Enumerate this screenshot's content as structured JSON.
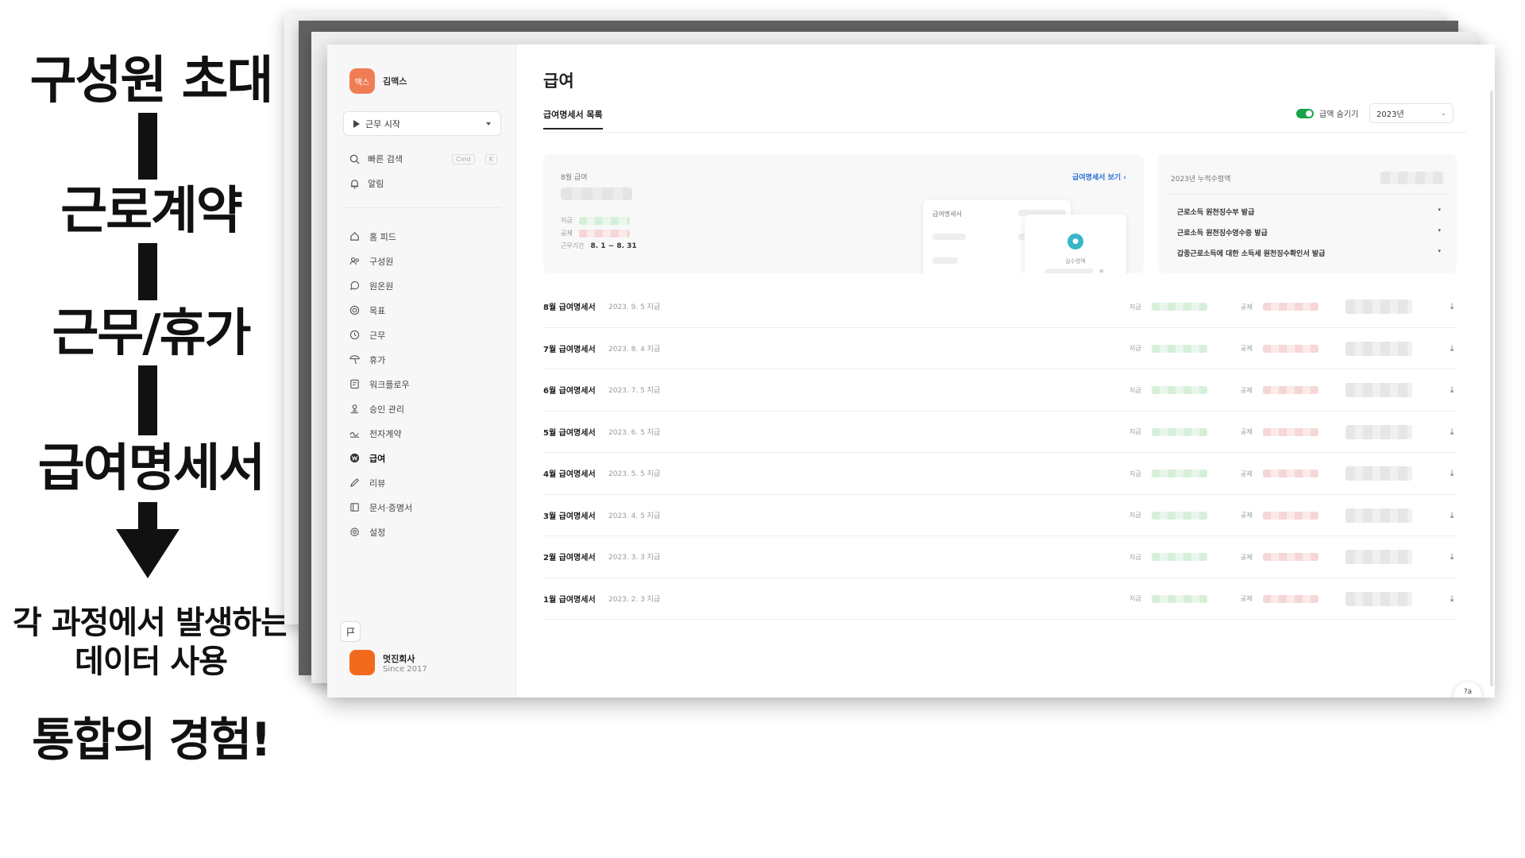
{
  "flow": {
    "steps": [
      "구성원 초대",
      "근로계약",
      "근무/휴가",
      "급여명세서"
    ],
    "desc_line1": "각 과정에서 발생하는",
    "desc_line2": "데이터 사용",
    "final": "통합의 경험!"
  },
  "app": {
    "profile": {
      "avatar_text": "맥스",
      "name": "김맥스"
    },
    "work_start_label": "근무 시작",
    "quick_search": {
      "label": "빠른 검색",
      "shortcut_1": "Cmd",
      "shortcut_2": "K"
    },
    "notification_label": "알림",
    "menu": [
      {
        "label": "홈 피드",
        "icon": "home-icon"
      },
      {
        "label": "구성원",
        "icon": "members-icon"
      },
      {
        "label": "원온원",
        "icon": "chat-icon"
      },
      {
        "label": "목표",
        "icon": "target-icon"
      },
      {
        "label": "근무",
        "icon": "clock-icon"
      },
      {
        "label": "휴가",
        "icon": "beach-icon"
      },
      {
        "label": "워크플로우",
        "icon": "workflow-icon"
      },
      {
        "label": "승인 관리",
        "icon": "approval-icon"
      },
      {
        "label": "전자계약",
        "icon": "contract-icon"
      },
      {
        "label": "급여",
        "icon": "won-icon"
      },
      {
        "label": "리뷰",
        "icon": "pen-icon"
      },
      {
        "label": "문서·증명서",
        "icon": "document-icon"
      },
      {
        "label": "설정",
        "icon": "gear-icon"
      }
    ],
    "active_menu": "급여",
    "company": {
      "name": "멋진회사",
      "since": "Since 2017"
    }
  },
  "main": {
    "title": "급여",
    "tab": "급여명세서 목록",
    "hide_amount_label": "급액 숨기기",
    "hide_amount_on": true,
    "year": "2023년",
    "summary": {
      "title": "8월 급여",
      "view_link": "급여명세서 보기",
      "pay_label": "지급",
      "deduct_label": "공제",
      "period_label": "근무기간",
      "period_value": "8. 1 ~ 8. 31",
      "mock_slip_title": "급여명세서",
      "mock_pop_title": "실수령액",
      "mock_pop_unit": "원"
    },
    "cumulative": {
      "title": "2023년 누적수령액",
      "items": [
        "근로소득 원천징수부 발급",
        "근로소득 원천징수영수증 발급",
        "갑종근로소득에 대한 소득세 원천징수확인서 발급"
      ]
    },
    "row_pay_label": "지급",
    "row_deduct_label": "공제",
    "payslips": [
      {
        "title": "8월 급여명세서",
        "date": "2023. 9. 5 지급"
      },
      {
        "title": "7월 급여명세서",
        "date": "2023. 8. 4 지급"
      },
      {
        "title": "6월 급여명세서",
        "date": "2023. 7. 5 지급"
      },
      {
        "title": "5월 급여명세서",
        "date": "2023. 6. 5 지급"
      },
      {
        "title": "4월 급여명세서",
        "date": "2023. 5. 5 지급"
      },
      {
        "title": "3월 급여명세서",
        "date": "2023. 4. 5 지급"
      },
      {
        "title": "2월 급여명세서",
        "date": "2023. 3. 3 지급"
      },
      {
        "title": "1월 급여명세서",
        "date": "2023. 2. 3 지급"
      }
    ],
    "help_label": "?a"
  },
  "colors": {
    "toggle_on": "#1aa34a",
    "avatar": "#f07c55",
    "company_logo": "#f26a1b",
    "link": "#2a6fd6"
  }
}
